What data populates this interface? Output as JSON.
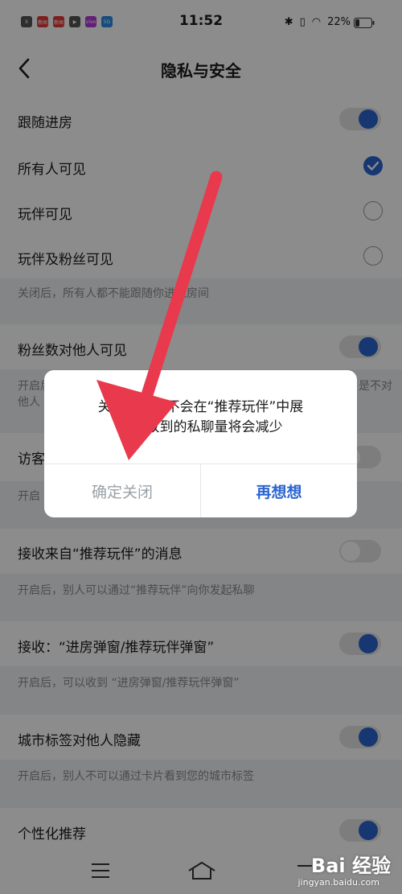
{
  "status_bar": {
    "time": "11:52",
    "battery": "22%",
    "app_icons": [
      {
        "label": "X",
        "color": "#555555"
      },
      {
        "label": "新闻",
        "color": "#e33a3a"
      },
      {
        "label": "新闻",
        "color": "#e33a3a"
      },
      {
        "label": "▶",
        "color": "#555555"
      },
      {
        "label": "vivo",
        "color": "#b03bd6"
      },
      {
        "label": "5G",
        "color": "#2a8be0"
      }
    ]
  },
  "nav": {
    "title": "隐私与安全",
    "back_icon": "chevron-left-icon"
  },
  "rows": {
    "follow_room": "跟随进房",
    "everyone_visible": "所有人可见",
    "partner_visible": "玩伴可见",
    "partner_fans_visible": "玩伴及粉丝可见",
    "follow_note": "关闭后，所有人都不能跟随你进入房间",
    "fans_count_visible": "粉丝数对他人可见",
    "fans_note_1": "开启后，",
    "fans_note_1_end": "是不对",
    "fans_note_2": "他人",
    "visitors": "访客",
    "visitors_note": "开启",
    "receive_recommend": "接收来自“推荐玩伴”的消息",
    "receive_recommend_note": "开启后，别人可以通过“推荐玩伴”向你发起私聊",
    "receive_popup": "接收：“进房弹窗/推荐玩伴弹窗”",
    "receive_popup_note": "开启后，可以收到 “进房弹窗/推荐玩伴弹窗”",
    "city_hidden": "城市标签对他人隐藏",
    "city_note": "开启后，别人不可以通过卡片看到您的城市标签",
    "personalized": "个性化推荐"
  },
  "dialog": {
    "message_line1": "关闭后，将不会在“推荐玩伴”中展",
    "message_line2": "示，收到的私聊量将会减少",
    "cancel_label": "确定关闭",
    "confirm_label": "再想想"
  },
  "watermark": {
    "main": "Bai 经验",
    "sub": "jingyan.baidu.com"
  },
  "colors": {
    "accent": "#2a65d0",
    "arrow": "#e8394d"
  }
}
